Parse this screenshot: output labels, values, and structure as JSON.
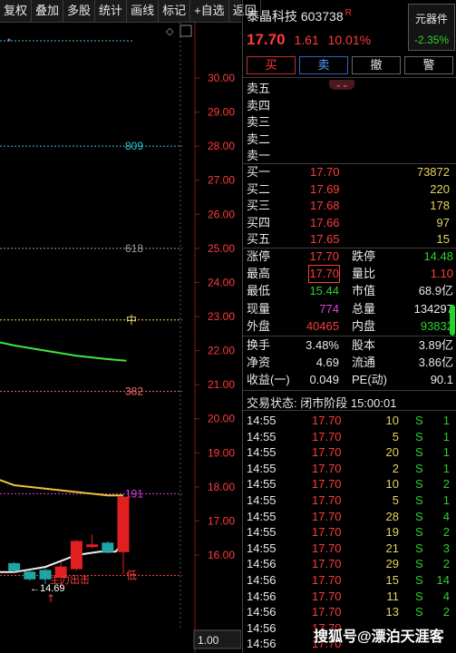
{
  "toolbar": [
    "复权",
    "叠加",
    "多股",
    "统计",
    "画线",
    "标记",
    "+自选",
    "返回"
  ],
  "stock": {
    "name": "泰晶科技",
    "code": "603738",
    "flag": "R",
    "price": "17.70",
    "change": "1.61",
    "change_pct": "10.01%"
  },
  "element_box": {
    "label": "元器件",
    "pct": "-2.35%"
  },
  "trade_buttons": [
    "买",
    "卖",
    "撤",
    "警"
  ],
  "collapse_icon": "chevron-down-icon",
  "sell_orders": [
    {
      "label": "卖五",
      "price": "",
      "vol": ""
    },
    {
      "label": "卖四",
      "price": "",
      "vol": ""
    },
    {
      "label": "卖三",
      "price": "",
      "vol": ""
    },
    {
      "label": "卖二",
      "price": "",
      "vol": ""
    },
    {
      "label": "卖一",
      "price": "",
      "vol": ""
    }
  ],
  "buy_orders": [
    {
      "label": "买一",
      "price": "17.70",
      "vol": "73872"
    },
    {
      "label": "买二",
      "price": "17.69",
      "vol": "220"
    },
    {
      "label": "买三",
      "price": "17.68",
      "vol": "178"
    },
    {
      "label": "买四",
      "price": "17.66",
      "vol": "97"
    },
    {
      "label": "买五",
      "price": "17.65",
      "vol": "15"
    }
  ],
  "quotes": [
    {
      "l1": "涨停",
      "v1": "17.70",
      "c1": "red",
      "l2": "跌停",
      "v2": "14.48",
      "c2": "green"
    },
    {
      "l1": "最高",
      "v1": "17.70",
      "c1": "red",
      "l2": "量比",
      "v2": "1.10",
      "c2": "red"
    },
    {
      "l1": "最低",
      "v1": "15.44",
      "c1": "green",
      "l2": "市值",
      "v2": "68.9亿",
      "c2": "white"
    },
    {
      "l1": "现量",
      "v1": "774",
      "c1": "magenta",
      "l2": "总量",
      "v2": "134297",
      "c2": "white"
    },
    {
      "l1": "外盘",
      "v1": "40465",
      "c1": "red",
      "l2": "内盘",
      "v2": "93832",
      "c2": "green"
    }
  ],
  "finance": [
    {
      "l1": "换手",
      "v1": "3.48%",
      "l2": "股本",
      "v2": "3.89亿"
    },
    {
      "l1": "净资",
      "v1": "4.69",
      "l2": "流通",
      "v2": "3.86亿"
    },
    {
      "l1": "收益(一)",
      "v1": "0.049",
      "l2": "PE(动)",
      "v2": "90.1"
    }
  ],
  "trade_status": "交易状态: 闭市阶段 15:00:01",
  "ticks": [
    {
      "time": "14:55",
      "price": "17.70",
      "vol": "10",
      "side": "S",
      "n": "1"
    },
    {
      "time": "14:55",
      "price": "17.70",
      "vol": "5",
      "side": "S",
      "n": "1"
    },
    {
      "time": "14:55",
      "price": "17.70",
      "vol": "20",
      "side": "S",
      "n": "1"
    },
    {
      "time": "14:55",
      "price": "17.70",
      "vol": "2",
      "side": "S",
      "n": "1"
    },
    {
      "time": "14:55",
      "price": "17.70",
      "vol": "10",
      "side": "S",
      "n": "2"
    },
    {
      "time": "14:55",
      "price": "17.70",
      "vol": "5",
      "side": "S",
      "n": "1"
    },
    {
      "time": "14:55",
      "price": "17.70",
      "vol": "28",
      "side": "S",
      "n": "4"
    },
    {
      "time": "14:55",
      "price": "17.70",
      "vol": "19",
      "side": "S",
      "n": "2"
    },
    {
      "time": "14:55",
      "price": "17.70",
      "vol": "21",
      "side": "S",
      "n": "3"
    },
    {
      "time": "14:56",
      "price": "17.70",
      "vol": "29",
      "side": "S",
      "n": "2"
    },
    {
      "time": "14:56",
      "price": "17.70",
      "vol": "15",
      "side": "S",
      "n": "14"
    },
    {
      "time": "14:56",
      "price": "17.70",
      "vol": "11",
      "side": "S",
      "n": "4"
    },
    {
      "time": "14:56",
      "price": "17.70",
      "vol": "13",
      "side": "S",
      "n": "2"
    },
    {
      "time": "14:56",
      "price": "17.70",
      "vol": "",
      "side": "",
      "n": ""
    },
    {
      "time": "14:56",
      "price": "17.70",
      "vol": "",
      "side": "",
      "n": ""
    }
  ],
  "watermark": "搜狐号@漂泊天涯客",
  "chart_data": {
    "type": "candlestick",
    "ylim": [
      15.0,
      30.6
    ],
    "ytick_labels": [
      "30.00",
      "29.00",
      "28.00",
      "27.00",
      "26.00",
      "25.00",
      "24.00",
      "23.00",
      "22.00",
      "21.00",
      "20.00",
      "19.00",
      "18.00",
      "17.00",
      "16.00"
    ],
    "ytick_values": [
      30,
      29,
      28,
      27,
      26,
      25,
      24,
      23,
      22,
      21,
      20,
      19,
      18,
      17,
      16
    ],
    "hlines": [
      {
        "label": "809",
        "value": 28.0,
        "color": "#2ec8d8"
      },
      {
        "label": "618",
        "value": 25.0,
        "color": "#9a9a9a"
      },
      {
        "label": "中",
        "value": 22.9,
        "color": "#e8d35a"
      },
      {
        "label": "382",
        "value": 20.8,
        "color": "#ff6a6a"
      },
      {
        "label": "191",
        "value": 17.8,
        "color": "#e040e0"
      },
      {
        "label": "低",
        "value": 15.4,
        "color": "#ff3b3b"
      }
    ],
    "candles": [
      {
        "x": 0,
        "open": 15.75,
        "close": 15.55,
        "high": 15.8,
        "low": 15.5
      },
      {
        "x": 1,
        "open": 15.5,
        "close": 15.3,
        "high": 15.55,
        "low": 15.25
      },
      {
        "x": 2,
        "open": 15.55,
        "close": 15.3,
        "high": 15.6,
        "low": 15.15
      },
      {
        "x": 3,
        "open": 15.35,
        "close": 15.65,
        "high": 15.8,
        "low": 15.0
      },
      {
        "x": 4,
        "open": 15.6,
        "close": 16.4,
        "high": 16.45,
        "low": 15.55
      },
      {
        "x": 5,
        "open": 16.3,
        "close": 16.3,
        "high": 16.6,
        "low": 16.2
      },
      {
        "x": 6,
        "open": 16.35,
        "close": 16.1,
        "high": 16.4,
        "low": 16.05
      },
      {
        "x": 7,
        "open": 16.1,
        "close": 17.7,
        "high": 17.7,
        "low": 15.44
      }
    ],
    "ma_yellow": [
      {
        "x": -5.8,
        "y": 19.7
      },
      {
        "x": -4.5,
        "y": 19.3
      },
      {
        "x": -3,
        "y": 18.8
      },
      {
        "x": -1.5,
        "y": 18.3
      },
      {
        "x": 0,
        "y": 18.05
      },
      {
        "x": 2,
        "y": 17.95
      },
      {
        "x": 4,
        "y": 17.85
      },
      {
        "x": 6,
        "y": 17.75
      },
      {
        "x": 7,
        "y": 17.75
      }
    ],
    "ma_green": [
      {
        "x": -5.8,
        "y": 22.9
      },
      {
        "x": -4,
        "y": 22.6
      },
      {
        "x": -2,
        "y": 22.35
      },
      {
        "x": 0,
        "y": 22.15
      },
      {
        "x": 2,
        "y": 22.0
      },
      {
        "x": 4,
        "y": 21.85
      },
      {
        "x": 6,
        "y": 21.75
      },
      {
        "x": 7.2,
        "y": 21.7
      }
    ],
    "ma_white": [
      {
        "x": -5.8,
        "y": 16.25
      },
      {
        "x": -4.5,
        "y": 16.0
      },
      {
        "x": -3,
        "y": 15.75
      },
      {
        "x": -1.5,
        "y": 15.5
      },
      {
        "x": 0,
        "y": 15.5
      },
      {
        "x": 2,
        "y": 15.65
      },
      {
        "x": 4,
        "y": 16.0
      },
      {
        "x": 5.5,
        "y": 16.1
      },
      {
        "x": 6.5,
        "y": 16.1
      },
      {
        "x": 7,
        "y": 16.35
      }
    ],
    "annotations": {
      "low_marker": "←14.69",
      "signal": "主力出击",
      "scale": "1.00"
    }
  }
}
